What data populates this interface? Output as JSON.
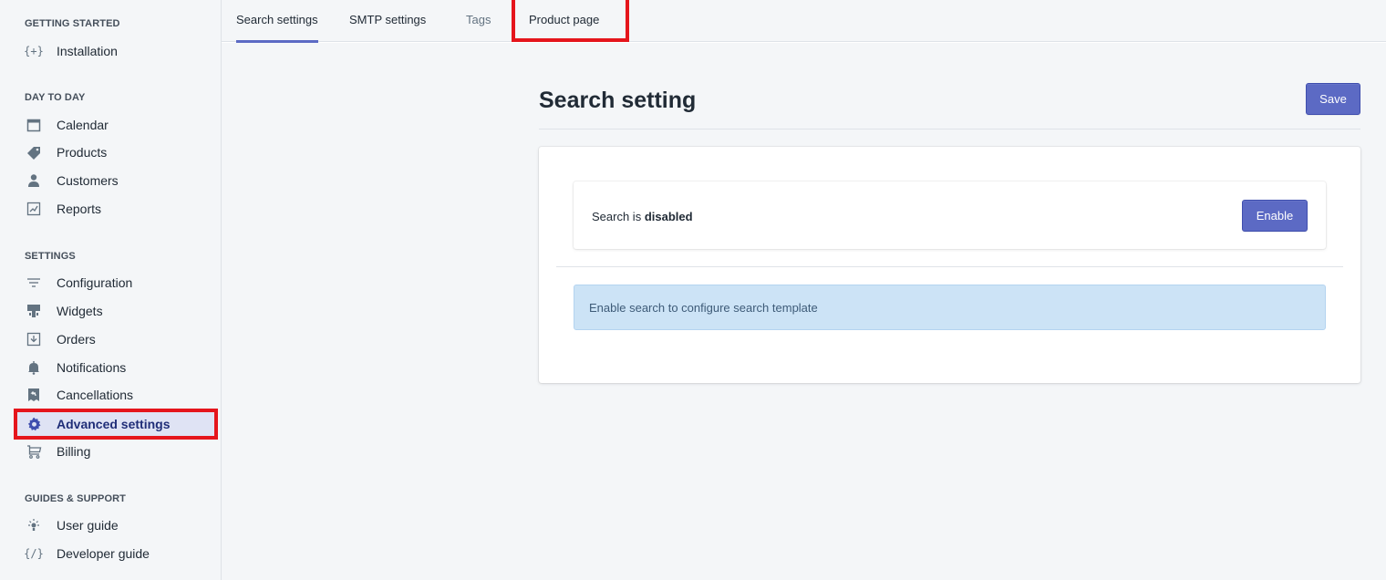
{
  "sidebar": {
    "sections": [
      {
        "title": "GETTING STARTED",
        "items": [
          {
            "label": "Installation",
            "icon": "braces-plus-icon"
          }
        ]
      },
      {
        "title": "DAY TO DAY",
        "items": [
          {
            "label": "Calendar",
            "icon": "calendar-icon"
          },
          {
            "label": "Products",
            "icon": "tag-icon"
          },
          {
            "label": "Customers",
            "icon": "person-icon"
          },
          {
            "label": "Reports",
            "icon": "chart-report-icon"
          }
        ]
      },
      {
        "title": "SETTINGS",
        "items": [
          {
            "label": "Configuration",
            "icon": "filter-lines-icon"
          },
          {
            "label": "Widgets",
            "icon": "widget-icon"
          },
          {
            "label": "Orders",
            "icon": "order-download-icon"
          },
          {
            "label": "Notifications",
            "icon": "bell-icon"
          },
          {
            "label": "Cancellations",
            "icon": "cancel-receipt-icon"
          },
          {
            "label": "Advanced settings",
            "icon": "gear-icon",
            "active": true
          },
          {
            "label": "Billing",
            "icon": "cart-icon"
          }
        ]
      },
      {
        "title": "GUIDES & SUPPORT",
        "items": [
          {
            "label": "User guide",
            "icon": "lightbulb-icon"
          },
          {
            "label": "Developer guide",
            "icon": "code-braces-icon"
          }
        ]
      }
    ]
  },
  "tabs": [
    {
      "label": "Search settings",
      "selected": true
    },
    {
      "label": "SMTP settings"
    },
    {
      "label": "Tags"
    },
    {
      "label": "Product page"
    }
  ],
  "page": {
    "title": "Search setting",
    "save_label": "Save"
  },
  "search_status": {
    "prefix": "Search is ",
    "state": "disabled",
    "enable_label": "Enable"
  },
  "info": {
    "message": "Enable search to configure search template"
  },
  "colors": {
    "accent": "#5c6ac4",
    "highlight": "#e5151c",
    "info_bg": "#cce3f6"
  }
}
